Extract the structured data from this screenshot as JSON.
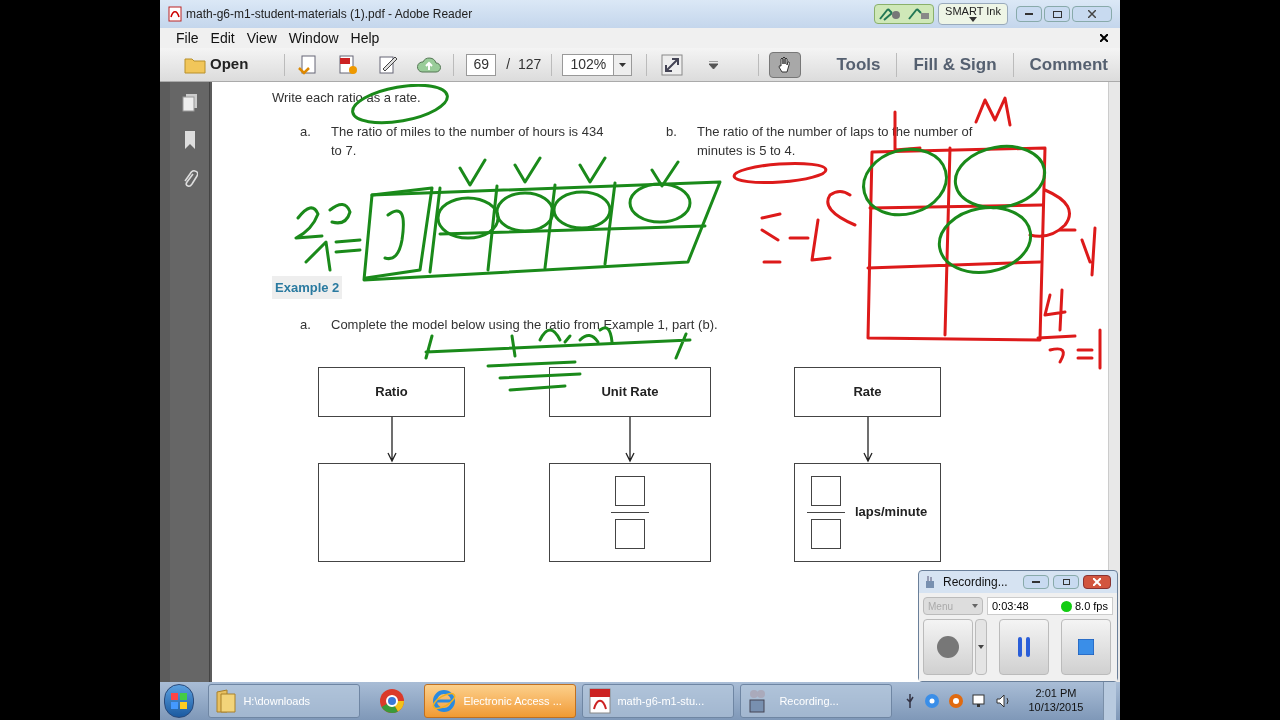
{
  "window": {
    "title": "math-g6-m1-student-materials (1).pdf - Adobe Reader"
  },
  "smart_ink": {
    "label": "SMART Ink"
  },
  "menu": [
    "File",
    "Edit",
    "View",
    "Window",
    "Help"
  ],
  "toolbar": {
    "open": "Open",
    "page": "69",
    "page_total": "/  127",
    "zoom": "102%",
    "panels": [
      "Tools",
      "Fill & Sign",
      "Comment"
    ]
  },
  "document": {
    "instruction": "Write each ratio as a rate.",
    "items": [
      {
        "marker": "a.",
        "text": "The ratio of miles to the number of hours is 434\nto 7."
      },
      {
        "marker": "b.",
        "text": "The ratio of the number of laps to the number of\nminutes is 5 to 4."
      }
    ],
    "example_heading": "Example 2",
    "task": {
      "marker": "a.",
      "text": "Complete the model below using the ratio from Example 1, part (b)."
    },
    "model": [
      {
        "kind": "empty",
        "header": "Ratio"
      },
      {
        "kind": "fraction",
        "header": "Unit Rate"
      },
      {
        "kind": "fraction_unit",
        "header": "Rate",
        "unit": "laps/minute"
      }
    ]
  },
  "recorder": {
    "title": "Recording...",
    "menu": "Menu",
    "time": "0:03:48",
    "fps": "8.0 fps"
  },
  "taskbar": {
    "items": [
      {
        "kind": "folder",
        "label": "H:\\downloads",
        "selected": false
      },
      {
        "kind": "chrome",
        "selected": false
      },
      {
        "kind": "ie",
        "label": "Electronic Access ...",
        "selected": true
      },
      {
        "kind": "pdf",
        "label": "math-g6-m1-stu...",
        "selected": false
      },
      {
        "kind": "recorder",
        "label": "Recording...",
        "selected": false
      }
    ],
    "time": "2:01 PM",
    "date": "10/13/2015"
  }
}
